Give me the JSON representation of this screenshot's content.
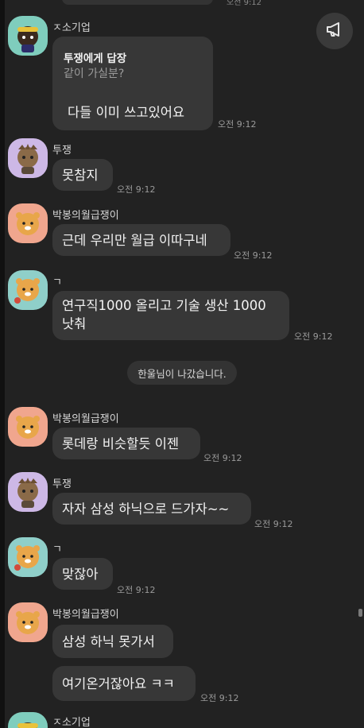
{
  "top_fragment_time": "오전 9:12",
  "icons": {
    "announce": "megaphone-icon",
    "avatar_blue_character": "muzi-avatar-icon",
    "avatar_lion_character": "ryan-avatar-icon",
    "avatar_purple_character": "tube-avatar-icon"
  },
  "colors": {
    "background": "#222222",
    "bubble": "#373737",
    "time": "#9a9a9a"
  },
  "messages": [
    {
      "sender": "ㅈ소기업",
      "reply": {
        "title": "투쟁에게 답장",
        "quote": "같이 가실분?",
        "text": "다들 이미 쓰고있어요"
      },
      "time": "오전 9:12"
    },
    {
      "sender": "투쟁",
      "text": "못참지",
      "time": "오전 9:12"
    },
    {
      "sender": "박봉의월급쟁이",
      "text": "근데 우리만 월급 이따구네",
      "time": "오전 9:12"
    },
    {
      "sender": "ㄱ",
      "text": "연구직1000 올리고 기술 생산 1000\n낫춰",
      "time": "오전 9:12"
    },
    {
      "sender": "박봉의월급쟁이",
      "text": "롯데랑 비슷할듯 이젠",
      "time": "오전 9:12"
    },
    {
      "sender": "투쟁",
      "text": "자자 삼성 하닉으로 드가자~~",
      "time": "오전 9:12"
    },
    {
      "sender": "ㄱ",
      "text": "맞잖아",
      "time": "오전 9:12"
    },
    {
      "sender": "박봉의월급쟁이",
      "text": "삼성 하닉 못가서",
      "text2": "여기온거잖아요 ㅋㅋ",
      "time": "오전 9:12"
    },
    {
      "sender": "ㅈ소기업"
    }
  ],
  "system_notice": "한울님이 나갔습니다."
}
